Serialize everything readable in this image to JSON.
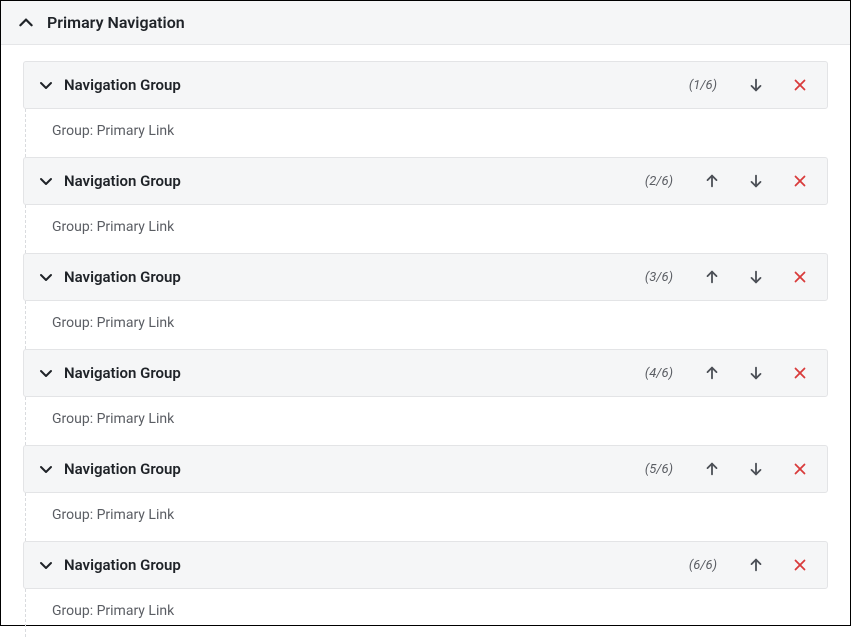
{
  "panel": {
    "title": "Primary Navigation"
  },
  "groups": [
    {
      "label": "Navigation Group",
      "counter": "(1/6)",
      "link_label": "Group: Primary Link",
      "show_up": false,
      "show_down": true
    },
    {
      "label": "Navigation Group",
      "counter": "(2/6)",
      "link_label": "Group: Primary Link",
      "show_up": true,
      "show_down": true
    },
    {
      "label": "Navigation Group",
      "counter": "(3/6)",
      "link_label": "Group: Primary Link",
      "show_up": true,
      "show_down": true
    },
    {
      "label": "Navigation Group",
      "counter": "(4/6)",
      "link_label": "Group: Primary Link",
      "show_up": true,
      "show_down": true
    },
    {
      "label": "Navigation Group",
      "counter": "(5/6)",
      "link_label": "Group: Primary Link",
      "show_up": true,
      "show_down": true
    },
    {
      "label": "Navigation Group",
      "counter": "(6/6)",
      "link_label": "Group: Primary Link",
      "show_up": true,
      "show_down": false
    }
  ],
  "colors": {
    "arrow": "#4b4f56",
    "delete": "#d93b3b"
  }
}
